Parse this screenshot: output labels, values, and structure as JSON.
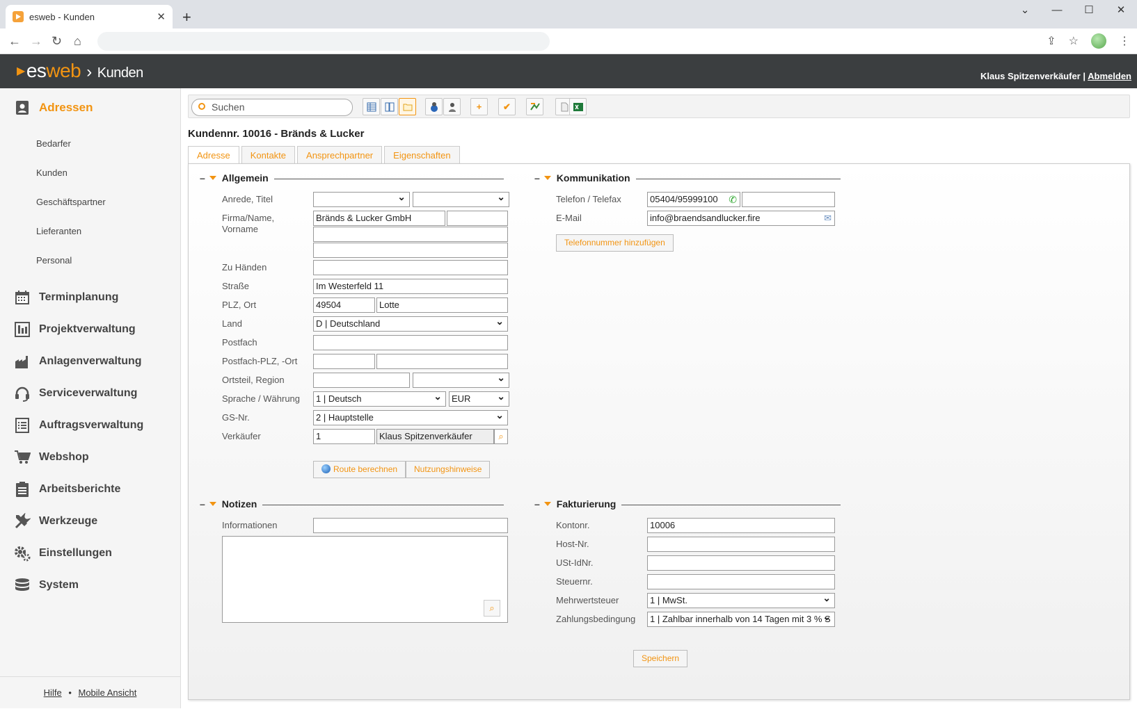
{
  "browser": {
    "tab_title": "esweb - Kunden",
    "newtab": "+",
    "close": "✕",
    "win_min": "⌄",
    "win_minimize": "—",
    "win_max": "☐",
    "win_close": "✕"
  },
  "header": {
    "logo_es": "es",
    "logo_web": "web",
    "section": "Kunden",
    "user": "Klaus Spitzenverkäufer",
    "sep": "|",
    "logout": "Abmelden"
  },
  "sidebar": {
    "active": "Adressen",
    "sub": [
      "Bedarfer",
      "Kunden",
      "Geschäftspartner",
      "Lieferanten",
      "Personal"
    ],
    "items": [
      "Terminplanung",
      "Projektverwaltung",
      "Anlagenverwaltung",
      "Serviceverwaltung",
      "Auftragsverwaltung",
      "Webshop",
      "Arbeitsberichte",
      "Werkzeuge",
      "Einstellungen",
      "System"
    ],
    "footer_help": "Hilfe",
    "footer_dot": "•",
    "footer_mobile": "Mobile Ansicht"
  },
  "toolbar": {
    "search_placeholder": "Suchen"
  },
  "customer": {
    "title": "Kundennr. 10016 - Bränds & Lucker"
  },
  "tabs": [
    "Adresse",
    "Kontakte",
    "Ansprechpartner",
    "Eigenschaften"
  ],
  "allgemein": {
    "heading": "Allgemein",
    "anrede_label": "Anrede, Titel",
    "firma_label": "Firma/Name,",
    "vorname_label": "Vorname",
    "firma_value": "Bränds & Lucker GmbH",
    "zuhaenden_label": "Zu Händen",
    "strasse_label": "Straße",
    "strasse_value": "Im Westerfeld 11",
    "plzort_label": "PLZ, Ort",
    "plz_value": "49504",
    "ort_value": "Lotte",
    "land_label": "Land",
    "land_value": "D | Deutschland",
    "postfach_label": "Postfach",
    "postfachplz_label": "Postfach-PLZ, -Ort",
    "ortsteil_label": "Ortsteil, Region",
    "sprache_label": "Sprache / Währung",
    "sprache_value": "1 | Deutsch",
    "waehrung_value": "EUR",
    "gsnr_label": "GS-Nr.",
    "gsnr_value": "2 | Hauptstelle",
    "verkaeufer_label": "Verkäufer",
    "verkaeufer_nr": "1",
    "verkaeufer_name": "Klaus Spitzenverkäufer",
    "route_btn": "Route berechnen",
    "nutzung_btn": "Nutzungshinweise"
  },
  "kommunikation": {
    "heading": "Kommunikation",
    "telefon_label": "Telefon / Telefax",
    "telefon_value": "05404/95999100",
    "email_label": "E-Mail",
    "email_value": "info@braendsandlucker.fire",
    "add_phone_btn": "Telefonnummer hinzufügen"
  },
  "notizen": {
    "heading": "Notizen",
    "info_label": "Informationen"
  },
  "fakturierung": {
    "heading": "Fakturierung",
    "kontonr_label": "Kontonr.",
    "kontonr_value": "10006",
    "hostnr_label": "Host-Nr.",
    "ustid_label": "USt-IdNr.",
    "steuer_label": "Steuernr.",
    "mwst_label": "Mehrwertsteuer",
    "mwst_value": "1 | MwSt.",
    "zahlung_label": "Zahlungsbedingung",
    "zahlung_value": "1 | Zahlbar innerhalb von 14 Tagen mit 3 % S"
  },
  "save_btn": "Speichern"
}
